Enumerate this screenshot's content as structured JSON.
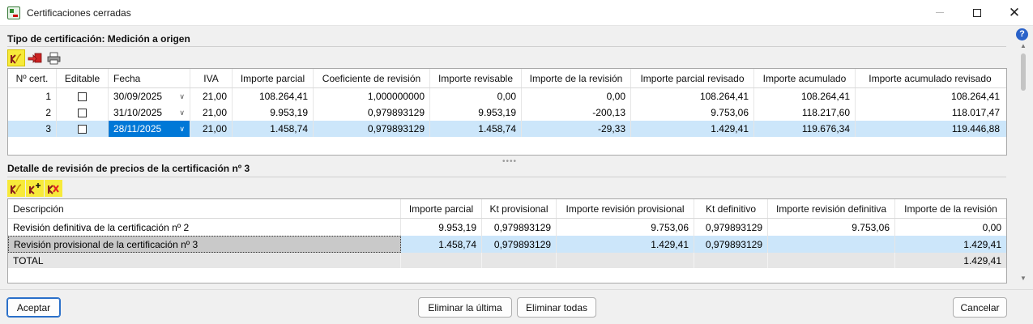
{
  "window": {
    "title": "Certificaciones cerradas"
  },
  "top_section": {
    "title": "Tipo de certificación: Medición a origen",
    "columns": [
      "Nº cert.",
      "Editable",
      "Fecha",
      "IVA",
      "Importe parcial",
      "Coeficiente de revisión",
      "Importe revisable",
      "Importe de la revisión",
      "Importe parcial revisado",
      "Importe acumulado",
      "Importe acumulado revisado"
    ],
    "rows": [
      {
        "num": "1",
        "editable": false,
        "fecha": "30/09/2025",
        "iva": "21,00",
        "importe_parcial": "108.264,41",
        "coef": "1,000000000",
        "importe_revisable": "0,00",
        "importe_revision": "0,00",
        "parcial_revisado": "108.264,41",
        "acumulado": "108.264,41",
        "acumulado_revisado": "108.264,41"
      },
      {
        "num": "2",
        "editable": false,
        "fecha": "31/10/2025",
        "iva": "21,00",
        "importe_parcial": "9.953,19",
        "coef": "0,979893129",
        "importe_revisable": "9.953,19",
        "importe_revision": "-200,13",
        "parcial_revisado": "9.753,06",
        "acumulado": "118.217,60",
        "acumulado_revisado": "118.017,47"
      },
      {
        "num": "3",
        "editable": false,
        "fecha": "28/11/2025",
        "iva": "21,00",
        "importe_parcial": "1.458,74",
        "coef": "0,979893129",
        "importe_revisable": "1.458,74",
        "importe_revision": "-29,33",
        "parcial_revisado": "1.429,41",
        "acumulado": "119.676,34",
        "acumulado_revisado": "119.446,88"
      }
    ]
  },
  "detail_section": {
    "title": "Detalle de revisión de precios de la certificación nº 3",
    "columns": [
      "Descripción",
      "Importe parcial",
      "Kt provisional",
      "Importe revisión provisional",
      "Kt definitivo",
      "Importe revisión definitiva",
      "Importe de la revisión"
    ],
    "rows": [
      {
        "desc": "Revisión definitiva de la certificación nº 2",
        "importe_parcial": "9.953,19",
        "kt_prov": "0,979893129",
        "rev_prov": "9.753,06",
        "kt_def": "0,979893129",
        "rev_def": "9.753,06",
        "importe_revision": "0,00"
      },
      {
        "desc": "Revisión provisional de la certificación nº 3",
        "importe_parcial": "1.458,74",
        "kt_prov": "0,979893129",
        "rev_prov": "1.429,41",
        "kt_def": "0,979893129",
        "rev_def": "",
        "importe_revision": "1.429,41"
      }
    ],
    "total": {
      "label": "TOTAL",
      "importe_revision": "1.429,41"
    }
  },
  "buttons": {
    "accept": "Aceptar",
    "delete_last": "Eliminar la última",
    "delete_all": "Eliminar todas",
    "cancel": "Cancelar"
  },
  "help": "?",
  "colors": {
    "selected_row": "#cce6fa",
    "selected_date": "#0078d7",
    "toolbar_highlight": "#f7ea3a",
    "total_row": "#e6e6e6"
  }
}
